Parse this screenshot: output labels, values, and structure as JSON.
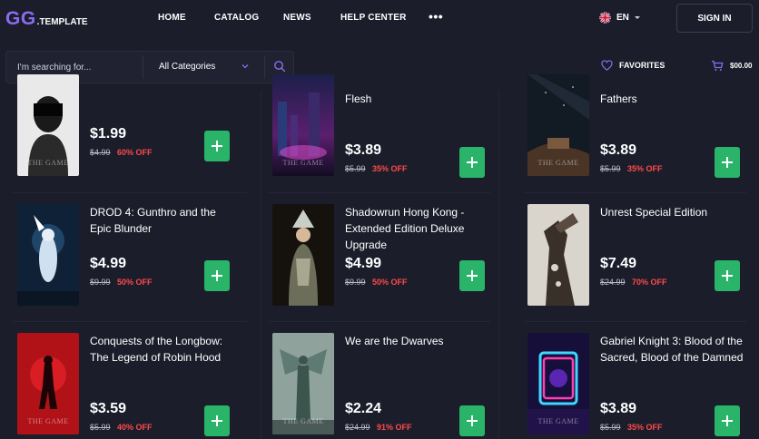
{
  "logo": {
    "main": "GG",
    "sub": ".TEMPLATE"
  },
  "nav": [
    {
      "label": "HOME"
    },
    {
      "label": "CATALOG"
    },
    {
      "label": "NEWS"
    },
    {
      "label": "HELP CENTER"
    }
  ],
  "nav_more": "•••",
  "language": "EN",
  "signin_label": "SIGN IN",
  "search": {
    "placeholder": "I'm searching for...",
    "category": "All Categories"
  },
  "favorites_label": "FAVORITES",
  "cart_total": "$00.00",
  "cover_caption": "THE GAME",
  "products": [
    {
      "title": "",
      "price": "$1.99",
      "old_price": "$4.99",
      "discount": "60% OFF"
    },
    {
      "title": "Flesh",
      "price": "$3.89",
      "old_price": "$5.99",
      "discount": "35% OFF"
    },
    {
      "title": "Fathers",
      "price": "$3.89",
      "old_price": "$5.99",
      "discount": "35% OFF"
    },
    {
      "title": "DROD 4: Gunthro and the Epic Blunder",
      "price": "$4.99",
      "old_price": "$9.99",
      "discount": "50% OFF"
    },
    {
      "title": "Shadowrun Hong Kong - Extended Edition Deluxe Upgrade",
      "price": "$4.99",
      "old_price": "$9.99",
      "discount": "50% OFF"
    },
    {
      "title": "Unrest Special Edition",
      "price": "$7.49",
      "old_price": "$24.99",
      "discount": "70% OFF"
    },
    {
      "title": "Conquests of the Longbow: The Legend of Robin Hood",
      "price": "$3.59",
      "old_price": "$5.99",
      "discount": "40% OFF"
    },
    {
      "title": "We are the Dwarves",
      "price": "$2.24",
      "old_price": "$24.99",
      "discount": "91% OFF"
    },
    {
      "title": "Gabriel Knight 3: Blood of the Sacred, Blood of the Damned",
      "price": "$3.89",
      "old_price": "$5.99",
      "discount": "35% OFF"
    }
  ],
  "colors": {
    "background": "#1b1d2a",
    "accent": "#8b6cf0",
    "add_button": "#29b46a",
    "discount": "#ff4a4a"
  }
}
